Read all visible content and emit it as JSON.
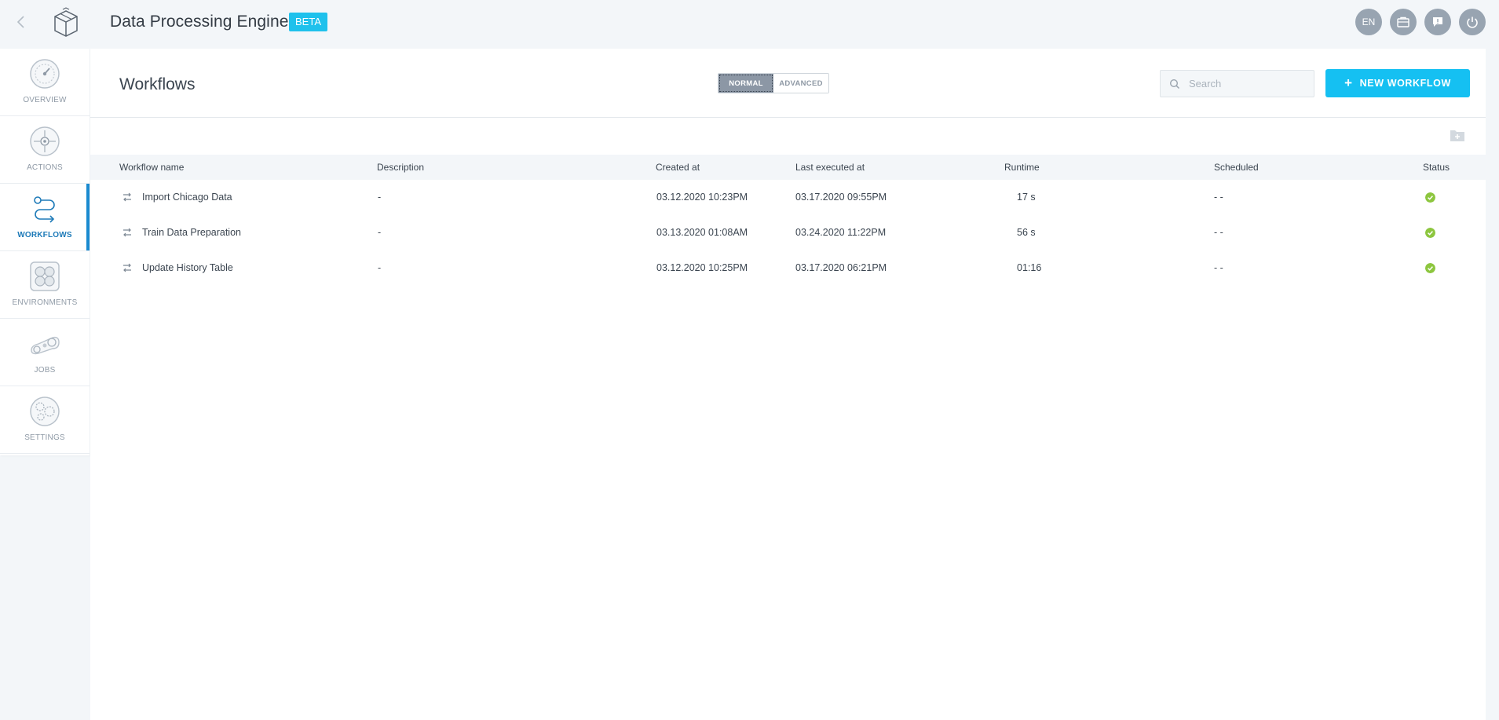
{
  "app": {
    "title": "Data Processing Engine",
    "badge": "BETA",
    "accent_color": "#15c0f2"
  },
  "header_actions": [
    {
      "name": "language-button",
      "label": "EN",
      "icon": "none"
    },
    {
      "name": "briefcase-button",
      "label": "",
      "icon": "briefcase-icon"
    },
    {
      "name": "feedback-button",
      "label": "",
      "icon": "chat-alert-icon"
    },
    {
      "name": "power-button",
      "label": "",
      "icon": "power-icon"
    }
  ],
  "sidebar": {
    "items": [
      {
        "label": "OVERVIEW",
        "icon": "gauge-icon",
        "active": false
      },
      {
        "label": "ACTIONS",
        "icon": "target-icon",
        "active": false
      },
      {
        "label": "WORKFLOWS",
        "icon": "workflow-icon",
        "active": true
      },
      {
        "label": "ENVIRONMENTS",
        "icon": "cluster-icon",
        "active": false
      },
      {
        "label": "JOBS",
        "icon": "gears-icon",
        "active": false
      },
      {
        "label": "SETTINGS",
        "icon": "settings-icon",
        "active": false
      }
    ]
  },
  "main": {
    "title": "Workflows",
    "mode_toggle": {
      "normal": "NORMAL",
      "advanced": "ADVANCED",
      "selected": "NORMAL"
    },
    "search": {
      "placeholder": "Search",
      "value": ""
    },
    "new_button": {
      "plus": "+",
      "label": "NEW WORKFLOW"
    }
  },
  "table": {
    "columns": [
      "Workflow name",
      "Description",
      "Created at",
      "Last executed at",
      "Runtime",
      "Scheduled",
      "Status"
    ],
    "rows": [
      {
        "name": "Import Chicago Data",
        "description": "-",
        "created": "03.12.2020 10:23PM",
        "last_executed": "03.17.2020 09:55PM",
        "runtime": "17 s",
        "scheduled": "- -",
        "status": "success"
      },
      {
        "name": "Train Data Preparation",
        "description": "-",
        "created": "03.13.2020 01:08AM",
        "last_executed": "03.24.2020 11:22PM",
        "runtime": "56 s",
        "scheduled": "- -",
        "status": "success"
      },
      {
        "name": "Update History Table",
        "description": "-",
        "created": "03.12.2020 10:25PM",
        "last_executed": "03.17.2020 06:21PM",
        "runtime": "01:16",
        "scheduled": "- -",
        "status": "success"
      }
    ]
  }
}
